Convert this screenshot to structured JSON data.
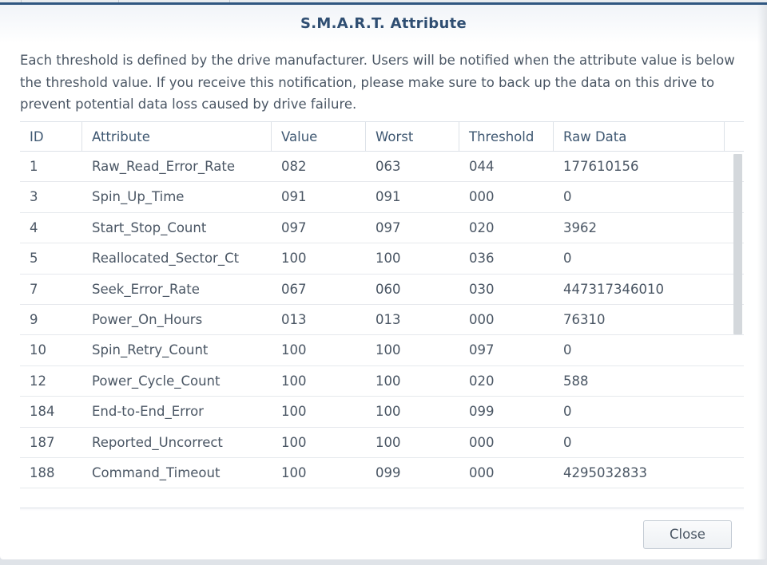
{
  "dialog": {
    "title": "S.M.A.R.T. Attribute",
    "description": "Each threshold is defined by the drive manufacturer. Users will be notified when the attribute value is below the threshold value. If you receive this notification, please make sure to back up the data on this drive to prevent potential data loss caused by drive failure.",
    "close_label": "Close"
  },
  "table": {
    "headers": [
      "ID",
      "Attribute",
      "Value",
      "Worst",
      "Threshold",
      "Raw Data"
    ],
    "rows": [
      [
        "1",
        "Raw_Read_Error_Rate",
        "082",
        "063",
        "044",
        "177610156"
      ],
      [
        "3",
        "Spin_Up_Time",
        "091",
        "091",
        "000",
        "0"
      ],
      [
        "4",
        "Start_Stop_Count",
        "097",
        "097",
        "020",
        "3962"
      ],
      [
        "5",
        "Reallocated_Sector_Ct",
        "100",
        "100",
        "036",
        "0"
      ],
      [
        "7",
        "Seek_Error_Rate",
        "067",
        "060",
        "030",
        "447317346010"
      ],
      [
        "9",
        "Power_On_Hours",
        "013",
        "013",
        "000",
        "76310"
      ],
      [
        "10",
        "Spin_Retry_Count",
        "100",
        "100",
        "097",
        "0"
      ],
      [
        "12",
        "Power_Cycle_Count",
        "100",
        "100",
        "020",
        "588"
      ],
      [
        "184",
        "End-to-End_Error",
        "100",
        "100",
        "099",
        "0"
      ],
      [
        "187",
        "Reported_Uncorrect",
        "100",
        "100",
        "000",
        "0"
      ],
      [
        "188",
        "Command_Timeout",
        "100",
        "099",
        "000",
        "4295032833"
      ]
    ]
  },
  "colors": {
    "title": "#2f4e72",
    "accent_border": "#2f5680",
    "text": "#4a5664"
  }
}
